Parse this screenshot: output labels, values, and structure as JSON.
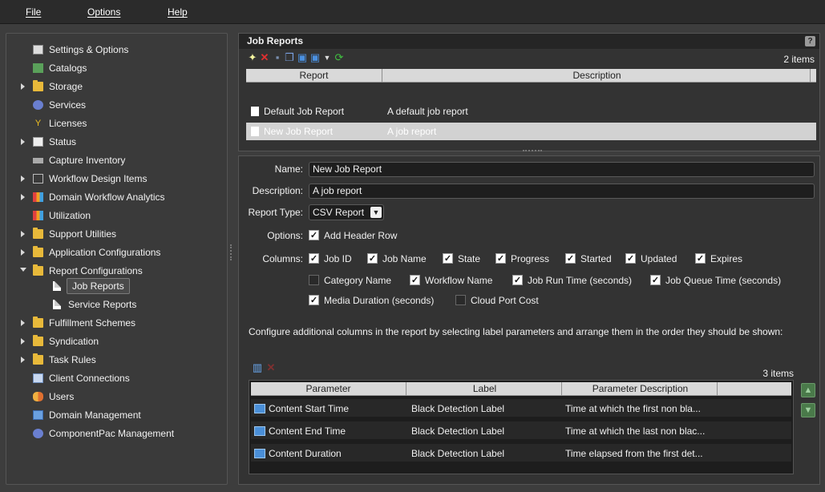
{
  "menu": {
    "file": "File",
    "options": "Options",
    "help": "Help"
  },
  "sidebar": {
    "items": [
      {
        "label": "Settings & Options",
        "icon": "settings-icon"
      },
      {
        "label": "Catalogs",
        "icon": "catalog-icon"
      },
      {
        "label": "Storage",
        "icon": "folder-icon"
      },
      {
        "label": "Services",
        "icon": "services-icon"
      },
      {
        "label": "Licenses",
        "icon": "key-icon"
      },
      {
        "label": "Status",
        "icon": "chart-icon"
      },
      {
        "label": "Capture Inventory",
        "icon": "capture-icon"
      },
      {
        "label": "Workflow Design Items",
        "icon": "workflow-icon"
      },
      {
        "label": "Domain Workflow Analytics",
        "icon": "bar-chart-icon"
      },
      {
        "label": "Utilization",
        "icon": "bar-chart-icon"
      },
      {
        "label": "Support Utilities",
        "icon": "folder-icon"
      },
      {
        "label": "Application Configurations",
        "icon": "folder-icon"
      },
      {
        "label": "Report Configurations",
        "icon": "folder-icon"
      },
      {
        "label": "Job Reports",
        "icon": "page-icon"
      },
      {
        "label": "Service Reports",
        "icon": "page-icon"
      },
      {
        "label": "Fulfillment Schemes",
        "icon": "folder-icon"
      },
      {
        "label": "Syndication",
        "icon": "folder-icon"
      },
      {
        "label": "Task Rules",
        "icon": "folder-icon"
      },
      {
        "label": "Client Connections",
        "icon": "connection-icon"
      },
      {
        "label": "Users",
        "icon": "users-icon"
      },
      {
        "label": "Domain Management",
        "icon": "domain-icon"
      },
      {
        "label": "ComponentPac Management",
        "icon": "services-icon"
      }
    ]
  },
  "job_reports": {
    "title": "Job Reports",
    "help": "?",
    "count": "2 items",
    "columns": [
      "Report",
      "Description"
    ],
    "rows": [
      {
        "report": "Default Job Report",
        "description": "A default job report"
      },
      {
        "report": "New Job Report",
        "description": "A job report"
      }
    ]
  },
  "form": {
    "name_label": "Name:",
    "name_value": "New Job Report",
    "description_label": "Description:",
    "description_value": "A job report",
    "report_type_label": "Report Type:",
    "report_type_value": "CSV Report",
    "options_label": "Options:",
    "add_header_row": "Add Header Row",
    "columns_label": "Columns:",
    "columns": [
      {
        "label": "Job ID",
        "checked": true
      },
      {
        "label": "Job Name",
        "checked": true
      },
      {
        "label": "State",
        "checked": true
      },
      {
        "label": "Progress",
        "checked": true
      },
      {
        "label": "Started",
        "checked": true
      },
      {
        "label": "Updated",
        "checked": true
      },
      {
        "label": "Expires",
        "checked": true
      },
      {
        "label": "Category Name",
        "checked": false
      },
      {
        "label": "Workflow Name",
        "checked": true
      },
      {
        "label": "Job Run Time (seconds)",
        "checked": true
      },
      {
        "label": "Job Queue Time (seconds)",
        "checked": true
      },
      {
        "label": "Media Duration (seconds)",
        "checked": true
      },
      {
        "label": "Cloud Port Cost",
        "checked": false
      }
    ],
    "note": "Configure additional columns in the report by selecting label parameters and arrange them in the order they should be shown:"
  },
  "params": {
    "count": "3 items",
    "columns": [
      "Parameter",
      "Label",
      "Parameter Description"
    ],
    "rows": [
      {
        "parameter": "Content Start Time",
        "label": "Black Detection Label",
        "description": "Time at which the first non bla..."
      },
      {
        "parameter": "Content End Time",
        "label": "Black Detection Label",
        "description": "Time at which the last non blac..."
      },
      {
        "parameter": "Content Duration",
        "label": "Black Detection Label",
        "description": "Time elapsed from the first det..."
      }
    ]
  }
}
